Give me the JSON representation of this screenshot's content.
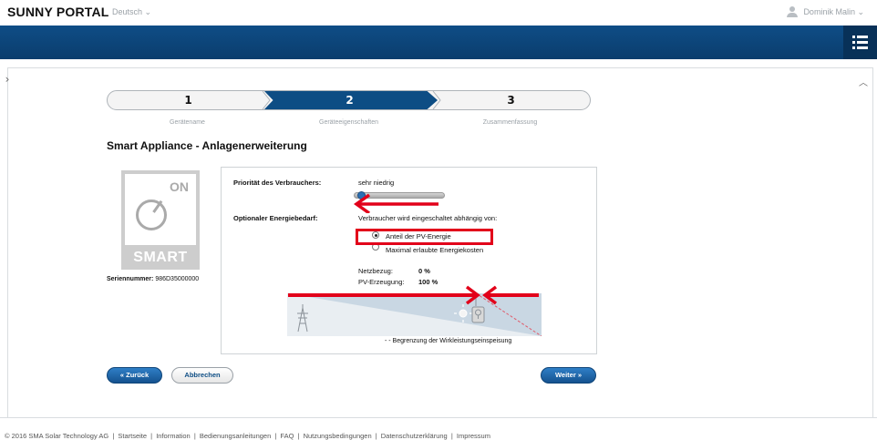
{
  "header": {
    "brand": "SUNNY PORTAL",
    "language": "Deutsch ⌄",
    "user": "Dominik Malin ⌄"
  },
  "stepper": {
    "steps": [
      {
        "number": "1",
        "label": "Gerätename"
      },
      {
        "number": "2",
        "label": "Geräteeigenschaften"
      },
      {
        "number": "3",
        "label": "Zusammenfassung"
      }
    ],
    "active_step": 2
  },
  "page_title": "Smart Appliance - Anlagenerweiterung",
  "device": {
    "on_text": "ON",
    "smart_text": "SMART",
    "serial_label": "Seriennummer:",
    "serial_value": "986D35000000"
  },
  "form": {
    "priority_label": "Priorität des Verbrauchers:",
    "priority_value": "sehr niedrig",
    "priority_level": 0,
    "energy_label": "Optionaler Energiebedarf:",
    "energy_intro": "Verbraucher wird eingeschaltet abhängig von:",
    "options": [
      {
        "label": "Anteil der PV-Energie",
        "selected": true
      },
      {
        "label": "Maximal erlaubte Energiekosten",
        "selected": false
      }
    ],
    "grid_label": "Netzbezug:",
    "grid_value": "0 %",
    "pv_label": "PV-Erzeugung:",
    "pv_value": "100 %",
    "legend": "- - Begrenzung der Wirkleistungseinspeisung"
  },
  "buttons": {
    "back": "« Zurück",
    "cancel": "Abbrechen",
    "next": "Weiter »"
  },
  "footer": {
    "copyright": "© 2016 SMA Solar Technology AG",
    "links": [
      "Startseite",
      "Information",
      "Bedienungsanleitungen",
      "FAQ",
      "Nutzungsbedingungen",
      "Datenschutzerklärung",
      "Impressum"
    ]
  },
  "colors": {
    "nav_blue": "#0d4d84",
    "highlight_red": "#e2001a"
  }
}
